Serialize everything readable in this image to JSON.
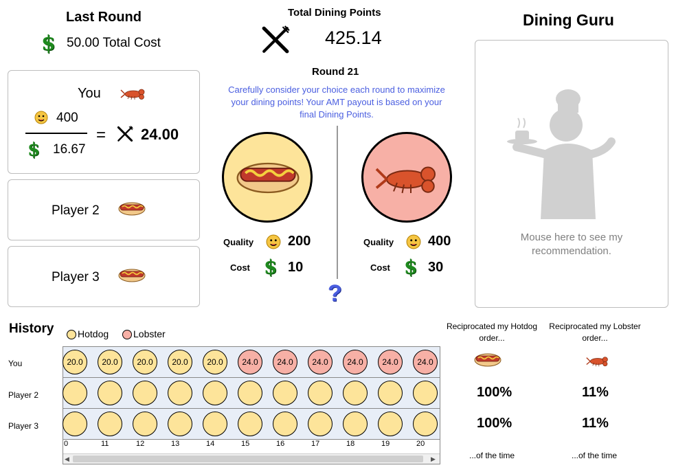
{
  "last_round": {
    "title": "Last Round",
    "total_cost": "50.00 Total Cost"
  },
  "total_points": {
    "title": "Total Dining Points",
    "value": "425.14"
  },
  "guru": {
    "title": "Dining Guru",
    "hint": "Mouse here to see my recommendation."
  },
  "round": {
    "title": "Round 21",
    "instructions": "Carefully consider your choice each round to maximize your dining points!  Your AMT payout is based on your final Dining Points."
  },
  "you_panel": {
    "label": "You",
    "quality": "400",
    "cost": "16.67",
    "equals": "=",
    "points": "24.00"
  },
  "players": [
    {
      "label": "Player 2"
    },
    {
      "label": "Player 3"
    }
  ],
  "options": [
    {
      "name": "hotdog",
      "quality_label": "Quality",
      "quality": "200",
      "cost_label": "Cost",
      "cost": "10"
    },
    {
      "name": "lobster",
      "quality_label": "Quality",
      "quality": "400",
      "cost_label": "Cost",
      "cost": "30"
    }
  ],
  "question_mark": "?",
  "history": {
    "title": "History",
    "legend": [
      {
        "label": "Hotdog",
        "color": "#fde49a"
      },
      {
        "label": "Lobster",
        "color": "#f7b0a6"
      }
    ],
    "row_labels": [
      "You",
      "Player 2",
      "Player 3"
    ],
    "you_values": [
      "20.0",
      "20.0",
      "20.0",
      "20.0",
      "20.0",
      "24.0",
      "24.0",
      "24.0",
      "24.0",
      "24.0",
      "24.0"
    ],
    "ticks": [
      "0",
      "11",
      "12",
      "13",
      "14",
      "15",
      "16",
      "17",
      "18",
      "19",
      "20"
    ]
  },
  "reciprocation": {
    "hotdog_header": "Reciprocated my Hotdog order...",
    "lobster_header": "Reciprocated my Lobster order...",
    "p2_hotdog": "100%",
    "p2_lobster": "11%",
    "p3_hotdog": "100%",
    "p3_lobster": "11%",
    "footer": "...of the time"
  },
  "icons": {
    "dollar": "$",
    "fork_knife": "fork-knife-icon",
    "emoji": "yum-face-icon",
    "hotdog": "hotdog-icon",
    "lobster": "lobster-icon"
  }
}
